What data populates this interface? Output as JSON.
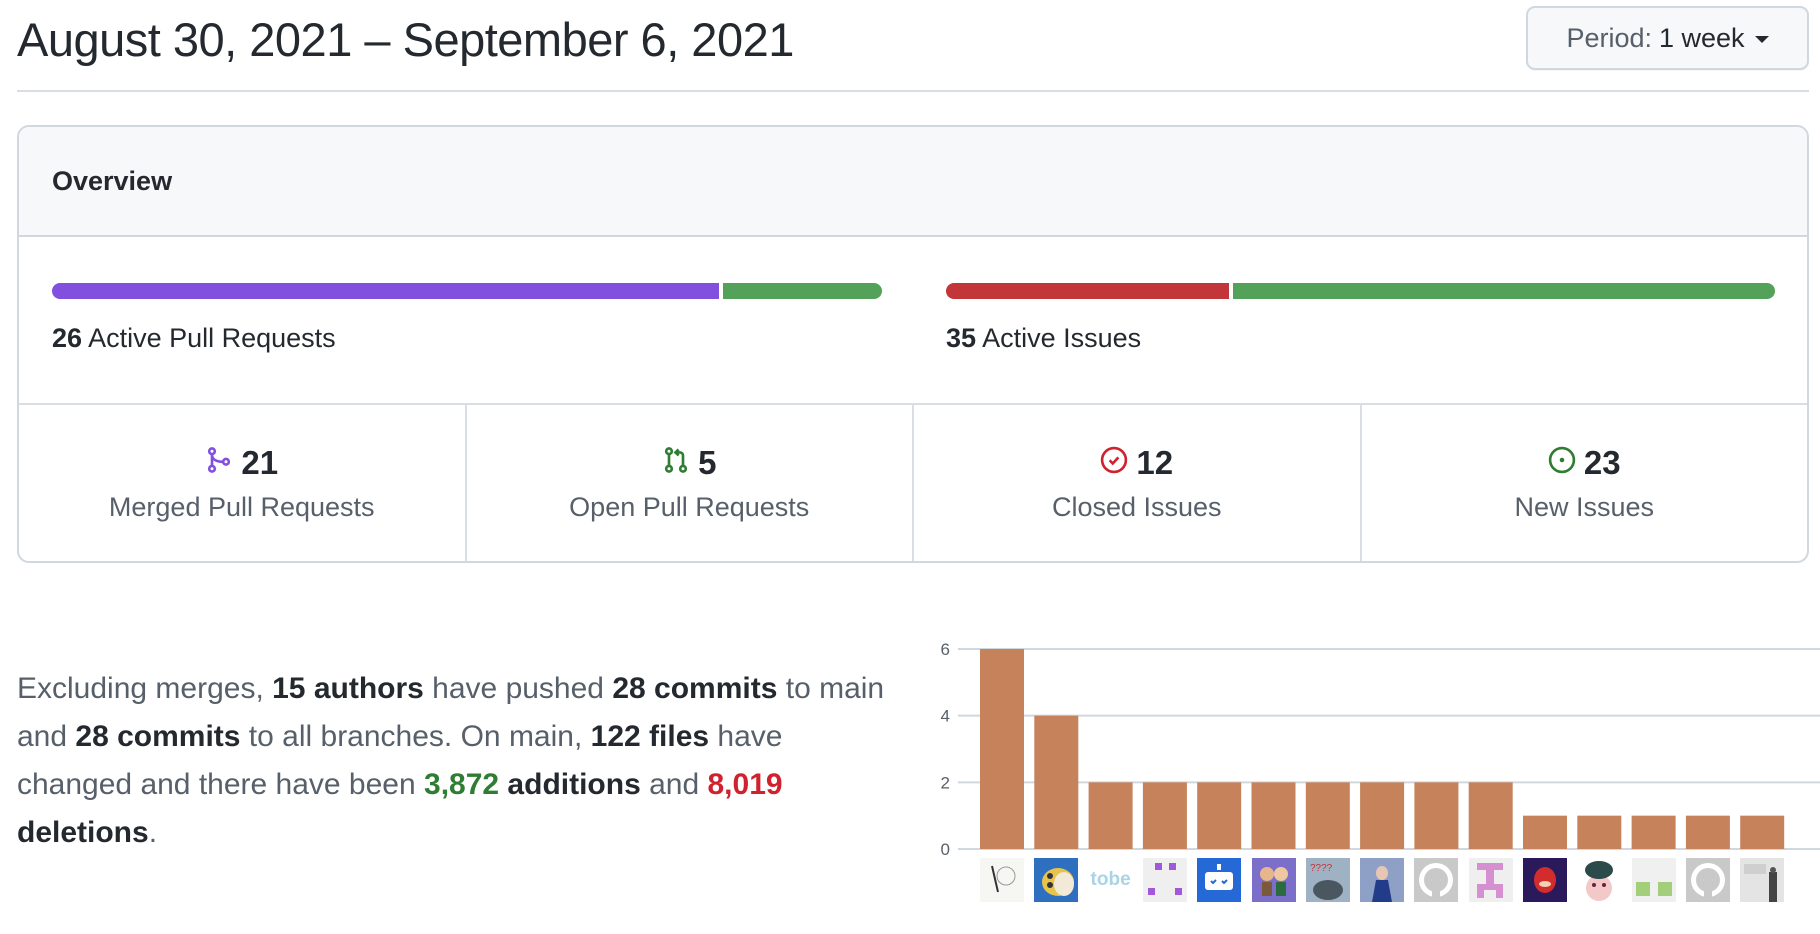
{
  "header": {
    "date_range": "August 30, 2021 – September 6, 2021",
    "period_label": "Period:",
    "period_value": "1 week"
  },
  "overview": {
    "title": "Overview",
    "pull_requests_bar": {
      "count": "26",
      "label": "Active Pull Requests",
      "segments": [
        {
          "name": "merged",
          "value": 21,
          "color": "#8250df"
        },
        {
          "name": "open",
          "value": 5,
          "color": "#54a15a"
        }
      ]
    },
    "issues_bar": {
      "count": "35",
      "label": "Active Issues",
      "segments": [
        {
          "name": "closed",
          "value": 12,
          "color": "#c23538"
        },
        {
          "name": "new",
          "value": 23,
          "color": "#54a15a"
        }
      ]
    },
    "stats": [
      {
        "icon": "git-merge-icon",
        "value": "21",
        "label": "Merged Pull Requests",
        "color": "#8250df"
      },
      {
        "icon": "git-pull-request-icon",
        "value": "5",
        "label": "Open Pull Requests",
        "color": "#2f7d32"
      },
      {
        "icon": "issue-closed-icon",
        "value": "12",
        "label": "Closed Issues",
        "color": "#cf222e"
      },
      {
        "icon": "issue-opened-icon",
        "value": "23",
        "label": "New Issues",
        "color": "#2f7d32"
      }
    ]
  },
  "summary": {
    "t1": "Excluding merges, ",
    "authors": "15 authors",
    "t2": " have pushed ",
    "commits_main": "28 commits",
    "t3": " to main and ",
    "commits_all": "28 commits",
    "t4": " to all branches. On main, ",
    "files": "122 files",
    "t5": " have changed and there have been ",
    "additions_num": "3,872",
    "additions_word": " additions",
    "t6": " and ",
    "deletions_num": "8,019",
    "deletions_word": " deletions",
    "t7": "."
  },
  "chart_data": {
    "type": "bar",
    "title": "",
    "xlabel": "",
    "ylabel": "",
    "categories": [
      "author-1",
      "author-2",
      "author-3 (tobe)",
      "author-4",
      "author-5",
      "author-6",
      "author-7",
      "author-8",
      "author-9",
      "author-10",
      "author-11",
      "author-12",
      "author-13",
      "author-14",
      "author-15"
    ],
    "values": [
      6,
      4,
      2,
      2,
      2,
      2,
      2,
      2,
      2,
      2,
      1,
      1,
      1,
      1,
      1
    ],
    "yticks": [
      0,
      2,
      4,
      6
    ],
    "ylim": [
      0,
      6
    ],
    "grid": true,
    "bar_color": "#c5825b",
    "avatars": [
      {
        "kind": "sketch",
        "bg": "#f6f6f2"
      },
      {
        "kind": "giraffe",
        "bg": "#2f6fbf"
      },
      {
        "kind": "text",
        "text": "tobe",
        "bg": "#ffffff",
        "fg": "#a9d4e6"
      },
      {
        "kind": "identicon",
        "bg": "#efefef",
        "fg": "#a259d9"
      },
      {
        "kind": "robot",
        "bg": "#2469d6"
      },
      {
        "kind": "cartoon",
        "bg": "#7b6fc9"
      },
      {
        "kind": "cat",
        "bg": "#9fb2c4"
      },
      {
        "kind": "photo",
        "bg": "#5a6aa8"
      },
      {
        "kind": "github",
        "bg": "#c9c9c9"
      },
      {
        "kind": "identicon2",
        "bg": "#efefef",
        "fg": "#d68fd0"
      },
      {
        "kind": "knuckles",
        "bg": "#2a1a5c"
      },
      {
        "kind": "hamster",
        "bg": "#ffffff"
      },
      {
        "kind": "identicon3",
        "bg": "#f0f0f0",
        "fg": "#a3cf7a"
      },
      {
        "kind": "github",
        "bg": "#c9c9c9"
      },
      {
        "kind": "photo2",
        "bg": "#e4e4e4"
      }
    ]
  }
}
